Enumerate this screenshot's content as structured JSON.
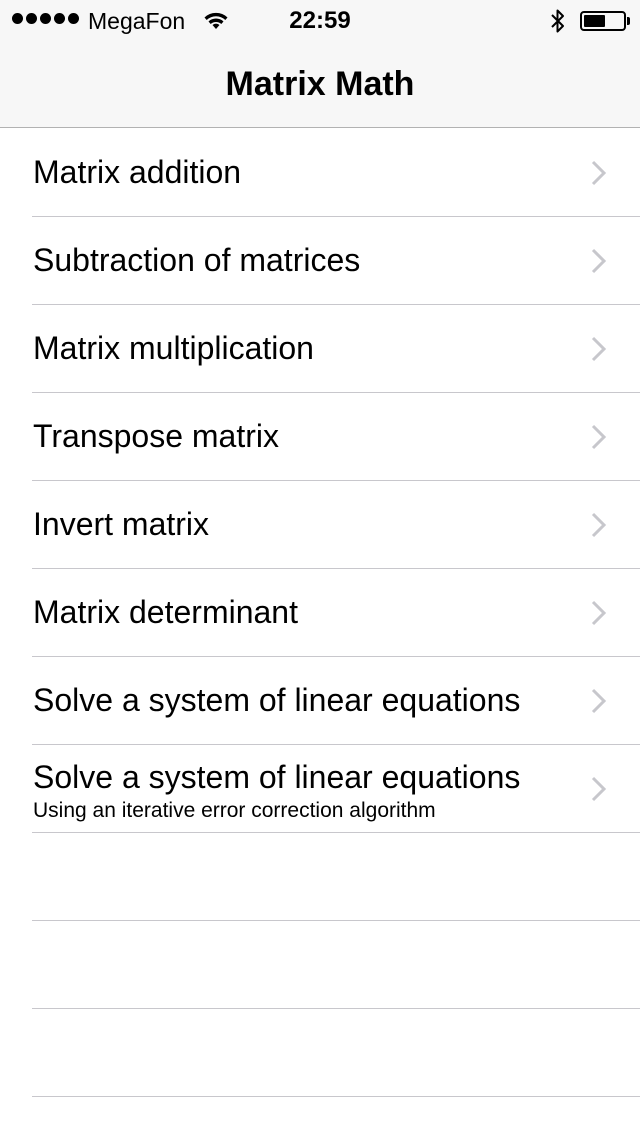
{
  "status_bar": {
    "carrier": "MegaFon",
    "time": "22:59",
    "signal_icon": "signal-dots-icon",
    "wifi_icon": "wifi-icon",
    "bluetooth_icon": "bluetooth-icon",
    "battery_icon": "battery-icon",
    "battery_level": 0.55
  },
  "nav": {
    "title": "Matrix Math"
  },
  "menu": {
    "items": [
      {
        "title": "Matrix addition"
      },
      {
        "title": "Subtraction of matrices"
      },
      {
        "title": "Matrix multiplication"
      },
      {
        "title": "Transpose matrix"
      },
      {
        "title": "Invert matrix"
      },
      {
        "title": "Matrix determinant"
      },
      {
        "title": "Solve a system of linear equations"
      },
      {
        "title": "Solve a system of linear equations",
        "subtitle": "Using an iterative error correction algorithm"
      }
    ],
    "chevron_icon": "chevron-right-icon",
    "chevron_color": "#c7c7cc",
    "separator_color": "#c8c7cc"
  }
}
